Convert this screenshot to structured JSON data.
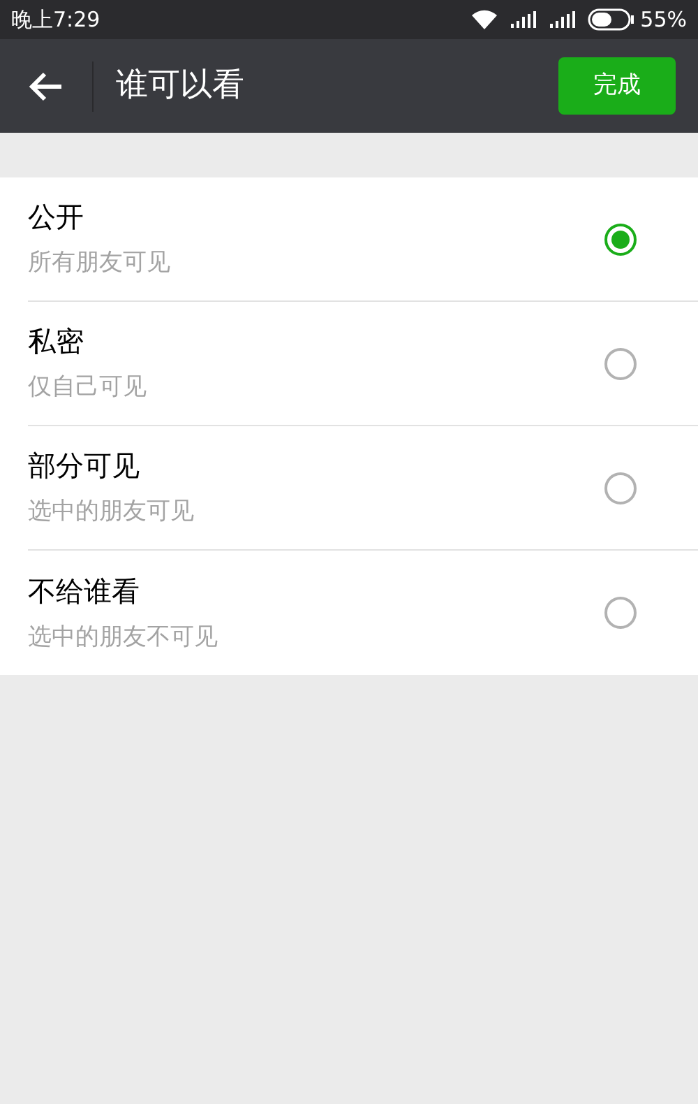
{
  "status_bar": {
    "time": "晚上7:29",
    "battery": "55%"
  },
  "header": {
    "title": "谁可以看",
    "done": "完成"
  },
  "options": [
    {
      "title": "公开",
      "subtitle": "所有朋友可见",
      "selected": true
    },
    {
      "title": "私密",
      "subtitle": "仅自己可见",
      "selected": false
    },
    {
      "title": "部分可见",
      "subtitle": "选中的朋友可见",
      "selected": false
    },
    {
      "title": "不给谁看",
      "subtitle": "选中的朋友不可见",
      "selected": false
    }
  ]
}
